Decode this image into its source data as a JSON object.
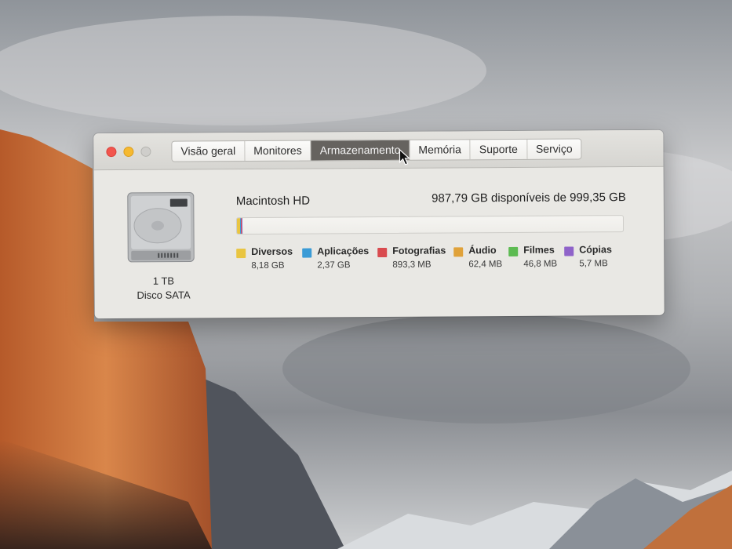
{
  "window": {
    "tabs": [
      {
        "label": "Visão geral"
      },
      {
        "label": "Monitores"
      },
      {
        "label": "Armazenamento"
      },
      {
        "label": "Memória"
      },
      {
        "label": "Suporte"
      },
      {
        "label": "Serviço"
      }
    ],
    "active_tab": "Armazenamento"
  },
  "disk": {
    "size": "1 TB",
    "type": "Disco SATA",
    "volume_name": "Macintosh HD",
    "availability": "987,79 GB disponíveis de 999,35 GB",
    "used_fraction": 0.0116,
    "categories": [
      {
        "name": "Diversos",
        "size": "8,18 GB",
        "color": "#e9c541"
      },
      {
        "name": "Aplicações",
        "size": "2,37 GB",
        "color": "#3a9bd6"
      },
      {
        "name": "Fotografias",
        "size": "893,3 MB",
        "color": "#d94b4f"
      },
      {
        "name": "Áudio",
        "size": "62,4 MB",
        "color": "#e0a23a"
      },
      {
        "name": "Filmes",
        "size": "46,8 MB",
        "color": "#5dbb52"
      },
      {
        "name": "Cópias",
        "size": "5,7 MB",
        "color": "#8f63c9"
      }
    ]
  },
  "colors": {
    "active_tab_bg": "#66635f",
    "window_bg": "#e9e8e4"
  }
}
